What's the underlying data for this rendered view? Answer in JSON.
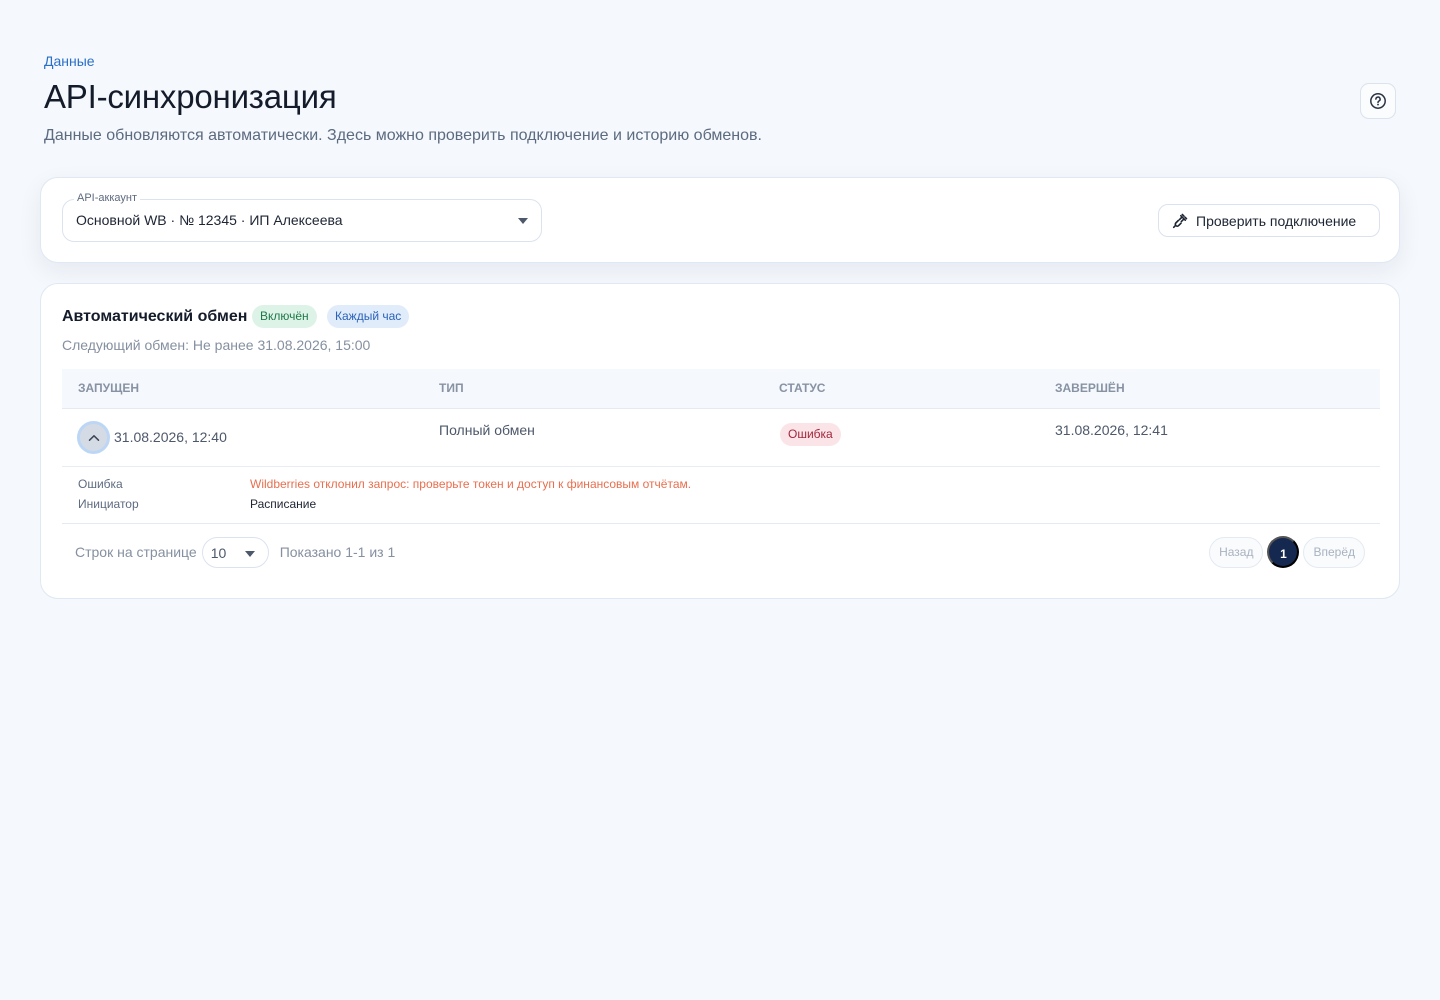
{
  "breadcrumb": "Данные",
  "page": {
    "title": "API-синхронизация",
    "subtitle": "Данные обновляются автоматически. Здесь можно проверить подключение и историю обменов."
  },
  "help": {
    "icon": "question-circle-icon"
  },
  "account": {
    "label": "API-аккаунт",
    "value": "Основной WB · № 12345 · ИП Алексеева",
    "check_button": "Проверить подключение",
    "check_icon": "plug-connection-icon"
  },
  "exchange": {
    "title": "Автоматический обмен",
    "status_badge": "Включён",
    "frequency_badge": "Каждый час",
    "next": "Следующий обмен: Не ранее 31.08.2026, 15:00"
  },
  "table": {
    "columns": [
      "Запущен",
      "Тип",
      "Статус",
      "Завершён"
    ],
    "rows": [
      {
        "started": "31.08.2026, 12:40",
        "type": "Полный обмен",
        "status": "Ошибка",
        "finished": "31.08.2026, 12:41",
        "details": {
          "error_label": "Ошибка",
          "error_text": "Wildberries отклонил запрос: проверьте токен и доступ к финансовым отчётам.",
          "initiator_label": "Инициатор",
          "initiator_value": "Расписание"
        }
      }
    ]
  },
  "footer": {
    "rows_per_page_label": "Строк на странице",
    "rows_per_page": "10",
    "shown": "Показано 1-1 из 1",
    "prev": "Назад",
    "current_page": "1",
    "next": "Вперёд"
  },
  "colors": {
    "accent": "#2a6fc9",
    "success_bg": "#ddf3e8",
    "error_text": "#e86f4f",
    "current_page_bg": "#15284f"
  }
}
